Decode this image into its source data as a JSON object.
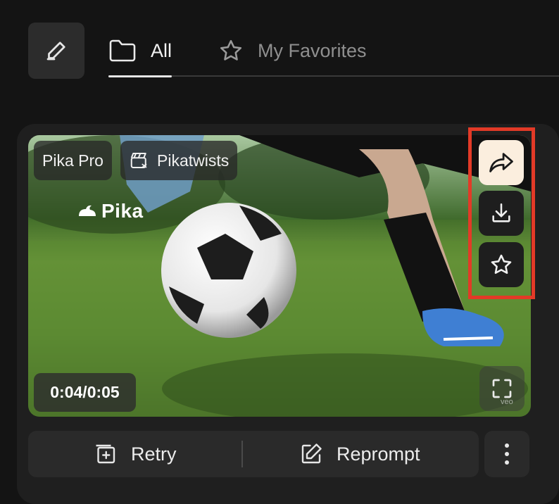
{
  "tabs": [
    {
      "label": "All",
      "icon": "folder-icon",
      "active": true
    },
    {
      "label": "My Favorites",
      "icon": "star-icon",
      "active": false
    }
  ],
  "card": {
    "badges": {
      "pro": "Pika Pro",
      "feature": "Pikatwists"
    },
    "logo_text": "Pika",
    "timecode": "0:04/0:05",
    "watermark": "veo",
    "actions": [
      "share-icon",
      "download-icon",
      "star-icon"
    ],
    "buttons": {
      "retry": "Retry",
      "reprompt": "Reprompt"
    }
  },
  "colors": {
    "highlight": "#e33a27",
    "share_bg": "#fbeede"
  }
}
